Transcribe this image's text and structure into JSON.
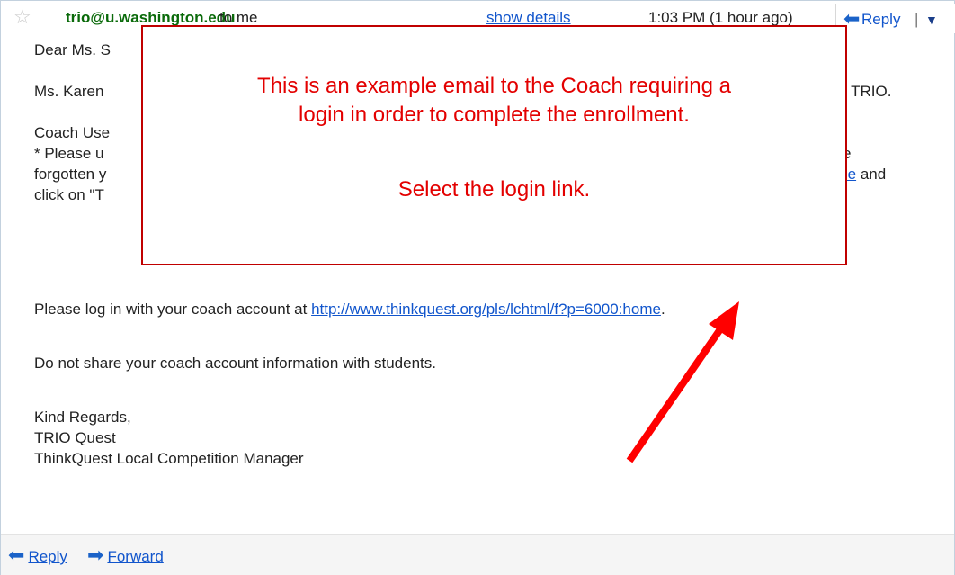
{
  "header": {
    "sender": "trio@u.washington.edu",
    "to": "to me",
    "show_details": "show details",
    "timestamp": "1:03 PM (1 hour ago)",
    "reply": "Reply",
    "more": "▼"
  },
  "email": {
    "greeting": "Dear Ms. S",
    "line_karen_start": "Ms. Karen",
    "line_karen_end": "est TRIO.",
    "coach_user_heading": "Coach Use",
    "bullet_start": "* Please u",
    "bullet_end": "ave",
    "forgotten_start": "forgotten y",
    "forgotten_link": "ome",
    "forgotten_end": "and",
    "click_on": "click on \"T",
    "login_text": "Please log in with your coach account at",
    "login_link": "http://www.thinkquest.org/pls/lchtml/f?p=6000:home",
    "login_period": ".",
    "share_warning": "Do not share your coach account information with students.",
    "signoff": "Kind Regards,",
    "sig_name": "TRIO Quest",
    "sig_title": "ThinkQuest Local Competition Manager"
  },
  "footer": {
    "reply": "Reply",
    "forward": "Forward"
  },
  "overlay": {
    "line1": "This is an example email to the Coach requiring a",
    "line2": "login in order to complete the enrollment.",
    "line3": "Select the login link."
  },
  "colors": {
    "overlay_border": "#c00000",
    "overlay_text": "#e30000",
    "arrow": "#ff0000",
    "link": "#1155cc",
    "sender": "#0a6a0a"
  },
  "icons": {
    "star": "star-icon",
    "reply": "reply-arrow-icon",
    "forward": "forward-arrow-icon",
    "dropdown": "dropdown-triangle-icon"
  }
}
